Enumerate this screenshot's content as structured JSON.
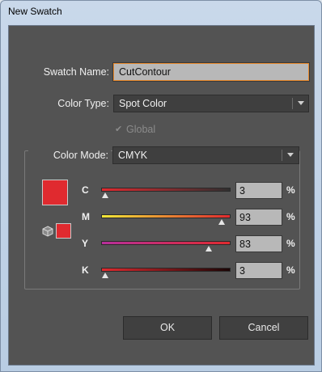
{
  "window": {
    "title": "New Swatch"
  },
  "swatch_name": {
    "label": "Swatch Name:",
    "value": "CutContour"
  },
  "color_type": {
    "label": "Color Type:",
    "selected": "Spot Color"
  },
  "global": {
    "label": "Global",
    "checked": true,
    "enabled": false
  },
  "color_mode": {
    "label": "Color Mode:",
    "selected": "CMYK"
  },
  "swatch_color": "#e02a2f",
  "channels": [
    {
      "key": "C",
      "value": "3",
      "fraction": 0.03,
      "unit": "%",
      "gradient": [
        "#e02a2f",
        "#2f2f2f"
      ]
    },
    {
      "key": "M",
      "value": "93",
      "fraction": 0.93,
      "unit": "%",
      "gradient": [
        "#f1e838",
        "#e02a2f"
      ]
    },
    {
      "key": "Y",
      "value": "83",
      "fraction": 0.83,
      "unit": "%",
      "gradient": [
        "#b72f9b",
        "#e02a2f"
      ]
    },
    {
      "key": "K",
      "value": "3",
      "fraction": 0.03,
      "unit": "%",
      "gradient": [
        "#e02a2f",
        "#1a0505"
      ]
    }
  ],
  "buttons": {
    "ok": "OK",
    "cancel": "Cancel"
  },
  "icons": {
    "color_model": "cube-icon",
    "dropdown": "chevron-down-icon",
    "check": "checkmark-icon"
  }
}
